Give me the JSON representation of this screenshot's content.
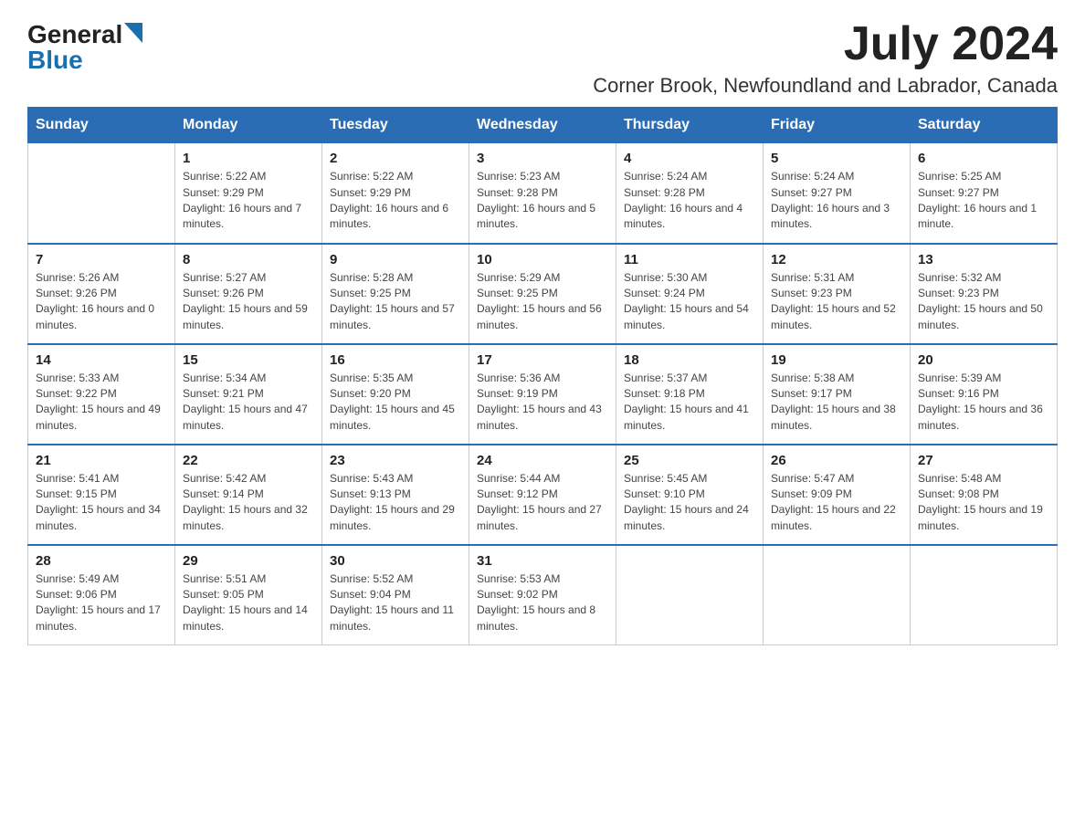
{
  "logo": {
    "general": "General",
    "blue": "Blue"
  },
  "title": {
    "month_year": "July 2024",
    "location": "Corner Brook, Newfoundland and Labrador, Canada"
  },
  "weekdays": [
    "Sunday",
    "Monday",
    "Tuesday",
    "Wednesday",
    "Thursday",
    "Friday",
    "Saturday"
  ],
  "weeks": [
    [
      {
        "day": "",
        "sunrise": "",
        "sunset": "",
        "daylight": ""
      },
      {
        "day": "1",
        "sunrise": "Sunrise: 5:22 AM",
        "sunset": "Sunset: 9:29 PM",
        "daylight": "Daylight: 16 hours and 7 minutes."
      },
      {
        "day": "2",
        "sunrise": "Sunrise: 5:22 AM",
        "sunset": "Sunset: 9:29 PM",
        "daylight": "Daylight: 16 hours and 6 minutes."
      },
      {
        "day": "3",
        "sunrise": "Sunrise: 5:23 AM",
        "sunset": "Sunset: 9:28 PM",
        "daylight": "Daylight: 16 hours and 5 minutes."
      },
      {
        "day": "4",
        "sunrise": "Sunrise: 5:24 AM",
        "sunset": "Sunset: 9:28 PM",
        "daylight": "Daylight: 16 hours and 4 minutes."
      },
      {
        "day": "5",
        "sunrise": "Sunrise: 5:24 AM",
        "sunset": "Sunset: 9:27 PM",
        "daylight": "Daylight: 16 hours and 3 minutes."
      },
      {
        "day": "6",
        "sunrise": "Sunrise: 5:25 AM",
        "sunset": "Sunset: 9:27 PM",
        "daylight": "Daylight: 16 hours and 1 minute."
      }
    ],
    [
      {
        "day": "7",
        "sunrise": "Sunrise: 5:26 AM",
        "sunset": "Sunset: 9:26 PM",
        "daylight": "Daylight: 16 hours and 0 minutes."
      },
      {
        "day": "8",
        "sunrise": "Sunrise: 5:27 AM",
        "sunset": "Sunset: 9:26 PM",
        "daylight": "Daylight: 15 hours and 59 minutes."
      },
      {
        "day": "9",
        "sunrise": "Sunrise: 5:28 AM",
        "sunset": "Sunset: 9:25 PM",
        "daylight": "Daylight: 15 hours and 57 minutes."
      },
      {
        "day": "10",
        "sunrise": "Sunrise: 5:29 AM",
        "sunset": "Sunset: 9:25 PM",
        "daylight": "Daylight: 15 hours and 56 minutes."
      },
      {
        "day": "11",
        "sunrise": "Sunrise: 5:30 AM",
        "sunset": "Sunset: 9:24 PM",
        "daylight": "Daylight: 15 hours and 54 minutes."
      },
      {
        "day": "12",
        "sunrise": "Sunrise: 5:31 AM",
        "sunset": "Sunset: 9:23 PM",
        "daylight": "Daylight: 15 hours and 52 minutes."
      },
      {
        "day": "13",
        "sunrise": "Sunrise: 5:32 AM",
        "sunset": "Sunset: 9:23 PM",
        "daylight": "Daylight: 15 hours and 50 minutes."
      }
    ],
    [
      {
        "day": "14",
        "sunrise": "Sunrise: 5:33 AM",
        "sunset": "Sunset: 9:22 PM",
        "daylight": "Daylight: 15 hours and 49 minutes."
      },
      {
        "day": "15",
        "sunrise": "Sunrise: 5:34 AM",
        "sunset": "Sunset: 9:21 PM",
        "daylight": "Daylight: 15 hours and 47 minutes."
      },
      {
        "day": "16",
        "sunrise": "Sunrise: 5:35 AM",
        "sunset": "Sunset: 9:20 PM",
        "daylight": "Daylight: 15 hours and 45 minutes."
      },
      {
        "day": "17",
        "sunrise": "Sunrise: 5:36 AM",
        "sunset": "Sunset: 9:19 PM",
        "daylight": "Daylight: 15 hours and 43 minutes."
      },
      {
        "day": "18",
        "sunrise": "Sunrise: 5:37 AM",
        "sunset": "Sunset: 9:18 PM",
        "daylight": "Daylight: 15 hours and 41 minutes."
      },
      {
        "day": "19",
        "sunrise": "Sunrise: 5:38 AM",
        "sunset": "Sunset: 9:17 PM",
        "daylight": "Daylight: 15 hours and 38 minutes."
      },
      {
        "day": "20",
        "sunrise": "Sunrise: 5:39 AM",
        "sunset": "Sunset: 9:16 PM",
        "daylight": "Daylight: 15 hours and 36 minutes."
      }
    ],
    [
      {
        "day": "21",
        "sunrise": "Sunrise: 5:41 AM",
        "sunset": "Sunset: 9:15 PM",
        "daylight": "Daylight: 15 hours and 34 minutes."
      },
      {
        "day": "22",
        "sunrise": "Sunrise: 5:42 AM",
        "sunset": "Sunset: 9:14 PM",
        "daylight": "Daylight: 15 hours and 32 minutes."
      },
      {
        "day": "23",
        "sunrise": "Sunrise: 5:43 AM",
        "sunset": "Sunset: 9:13 PM",
        "daylight": "Daylight: 15 hours and 29 minutes."
      },
      {
        "day": "24",
        "sunrise": "Sunrise: 5:44 AM",
        "sunset": "Sunset: 9:12 PM",
        "daylight": "Daylight: 15 hours and 27 minutes."
      },
      {
        "day": "25",
        "sunrise": "Sunrise: 5:45 AM",
        "sunset": "Sunset: 9:10 PM",
        "daylight": "Daylight: 15 hours and 24 minutes."
      },
      {
        "day": "26",
        "sunrise": "Sunrise: 5:47 AM",
        "sunset": "Sunset: 9:09 PM",
        "daylight": "Daylight: 15 hours and 22 minutes."
      },
      {
        "day": "27",
        "sunrise": "Sunrise: 5:48 AM",
        "sunset": "Sunset: 9:08 PM",
        "daylight": "Daylight: 15 hours and 19 minutes."
      }
    ],
    [
      {
        "day": "28",
        "sunrise": "Sunrise: 5:49 AM",
        "sunset": "Sunset: 9:06 PM",
        "daylight": "Daylight: 15 hours and 17 minutes."
      },
      {
        "day": "29",
        "sunrise": "Sunrise: 5:51 AM",
        "sunset": "Sunset: 9:05 PM",
        "daylight": "Daylight: 15 hours and 14 minutes."
      },
      {
        "day": "30",
        "sunrise": "Sunrise: 5:52 AM",
        "sunset": "Sunset: 9:04 PM",
        "daylight": "Daylight: 15 hours and 11 minutes."
      },
      {
        "day": "31",
        "sunrise": "Sunrise: 5:53 AM",
        "sunset": "Sunset: 9:02 PM",
        "daylight": "Daylight: 15 hours and 8 minutes."
      },
      {
        "day": "",
        "sunrise": "",
        "sunset": "",
        "daylight": ""
      },
      {
        "day": "",
        "sunrise": "",
        "sunset": "",
        "daylight": ""
      },
      {
        "day": "",
        "sunrise": "",
        "sunset": "",
        "daylight": ""
      }
    ]
  ]
}
